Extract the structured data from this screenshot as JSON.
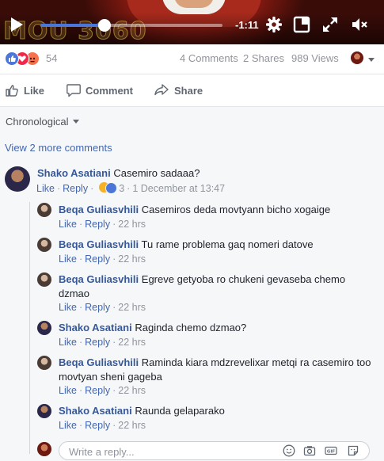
{
  "video": {
    "watermark": "MOU 3060",
    "time_remaining": "-1:11",
    "progress": 0.35,
    "icons": [
      "play-icon",
      "settings-gear-icon",
      "pip-icon",
      "fullscreen-icon",
      "volume-muted-icon"
    ]
  },
  "stats": {
    "reactions": [
      "like",
      "love",
      "angry"
    ],
    "reaction_count": "54",
    "comments": "4 Comments",
    "shares": "2 Shares",
    "views": "989 Views"
  },
  "actions": {
    "like": "Like",
    "comment": "Comment",
    "share": "Share"
  },
  "sort_label": "Chronological",
  "view_more": "View 2 more comments",
  "link_labels": {
    "like": "Like",
    "reply": "Reply"
  },
  "comment": {
    "author": "Shako Asatiani",
    "text": "Casemiro sadaaa?",
    "reaction_count": "3",
    "reactions": [
      "haha",
      "like"
    ],
    "time": "1 December at 13:47"
  },
  "replies": [
    {
      "author": "Beqa Guliasvhili",
      "text": "Casemiros deda movtyann bicho xogaige",
      "time": "22 hrs"
    },
    {
      "author": "Beqa Guliasvhili",
      "text": "Tu rame problema gaq nomeri datove",
      "time": "22 hrs"
    },
    {
      "author": "Beqa Guliasvhili",
      "text": "Egreve getyoba ro chukeni gevaseba chemo dzmao",
      "time": "22 hrs"
    },
    {
      "author": "Shako Asatiani",
      "text": "Raginda chemo dzmao?",
      "time": "22 hrs"
    },
    {
      "author": "Beqa Guliasvhili",
      "text": "Raminda kiara mdzrevelixar metqi ra casemiro too movtyan sheni gageba",
      "time": "22 hrs"
    },
    {
      "author": "Shako Asatiani",
      "text": "Raunda gelaparako",
      "time": "22 hrs"
    }
  ],
  "reply_box": {
    "placeholder": "Write a reply...",
    "icons": [
      "emoji-icon",
      "camera-icon",
      "gif-icon",
      "sticker-icon"
    ]
  },
  "colors": {
    "link": "#4267b2",
    "name": "#365899",
    "meta": "#90949c",
    "like_blue": "#4a76d9",
    "love_red": "#f0284a",
    "angry_orange": "#f7714c",
    "haha_yellow": "#f7b125"
  }
}
